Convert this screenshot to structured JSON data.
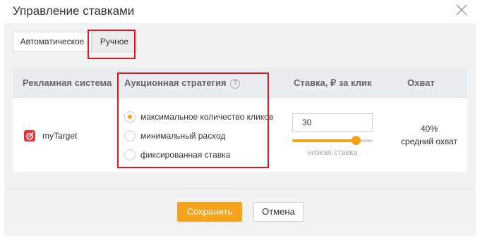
{
  "modal": {
    "title": "Управление ставками",
    "close_icon": "close-icon"
  },
  "tabs": [
    {
      "label": "Автоматическое",
      "active": false
    },
    {
      "label": "Ручное",
      "active": true
    }
  ],
  "table": {
    "headers": {
      "system": "Рекламная система",
      "strategy": "Аукционная стратегия",
      "bid": "Ставка, ₽ за клик",
      "reach": "Охват"
    },
    "help_icon_glyph": "?",
    "row": {
      "system_name": "myTarget",
      "system_icon": "mytarget-logo-icon",
      "strategy_options": [
        {
          "label": "максимальное количество кликов",
          "checked": true
        },
        {
          "label": "минимальный расход",
          "checked": false
        },
        {
          "label": "фиксированная ставка",
          "checked": false
        }
      ],
      "bid_value": "30",
      "slider_level_percent": 79,
      "slider_caption": "низкая ставка",
      "reach_value": "40%",
      "reach_label": "средний охват"
    }
  },
  "buttons": {
    "save": "Сохранить",
    "cancel": "Отмена"
  },
  "colors": {
    "accent": "#f5a31a",
    "highlight": "#e3161f",
    "brand_mytarget": "#e8333c"
  }
}
